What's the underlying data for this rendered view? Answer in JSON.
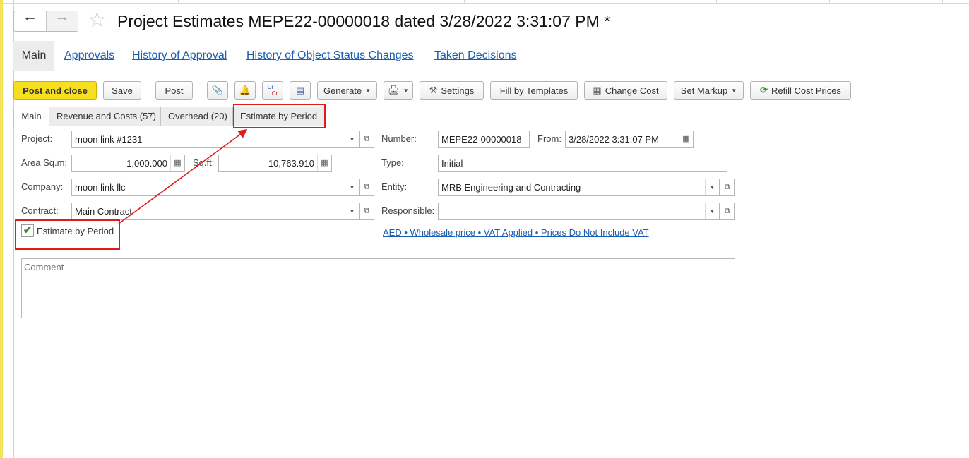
{
  "header": {
    "title": "Project Estimates MEPE22-00000018 dated 3/28/2022 3:31:07 PM *"
  },
  "section_tabs": [
    {
      "label": "Main"
    },
    {
      "label": "Approvals"
    },
    {
      "label": "History of Approval"
    },
    {
      "label": "History of Object Status Changes"
    },
    {
      "label": "Taken Decisions"
    }
  ],
  "toolbar": {
    "post_and_close": "Post and close",
    "save": "Save",
    "post": "Post",
    "generate": "Generate",
    "settings": "Settings",
    "fill_by_templates": "Fill by Templates",
    "change_cost": "Change Cost",
    "set_markup": "Set Markup",
    "refill_cost_prices": "Refill Cost Prices",
    "drcr_top": "Dr",
    "drcr_bottom": "Cr"
  },
  "form_tabs": [
    {
      "label": "Main"
    },
    {
      "label": "Revenue and Costs (57)"
    },
    {
      "label": "Overhead (20)"
    },
    {
      "label": "Estimate by Period"
    }
  ],
  "form": {
    "project_label": "Project:",
    "project_value": "moon link #1231",
    "area_label": "Area Sq.m:",
    "area_value": "1,000.000",
    "sqft_label": "Sq.ft:",
    "sqft_value": "10,763.910",
    "company_label": "Company:",
    "company_value": "moon link llc",
    "contract_label": "Contract:",
    "contract_value": "Main Contract",
    "number_label": "Number:",
    "number_value": "MEPE22-00000018",
    "from_label": "From:",
    "from_value": "3/28/2022  3:31:07 PM",
    "type_label": "Type:",
    "type_value": "Initial",
    "entity_label": "Entity:",
    "entity_value": "MRB Engineering and Contracting",
    "responsible_label": "Responsible:",
    "responsible_value": "",
    "estimate_by_period_label": "Estimate by Period",
    "estimate_by_period_checked": true,
    "pricing_link": "AED • Wholesale price • VAT Applied • Prices Do Not Include VAT",
    "comment_placeholder": "Comment"
  },
  "colors": {
    "accent_yellow": "#f6df1f",
    "link_blue": "#1a5eb0",
    "highlight_red": "#e01b1b"
  }
}
